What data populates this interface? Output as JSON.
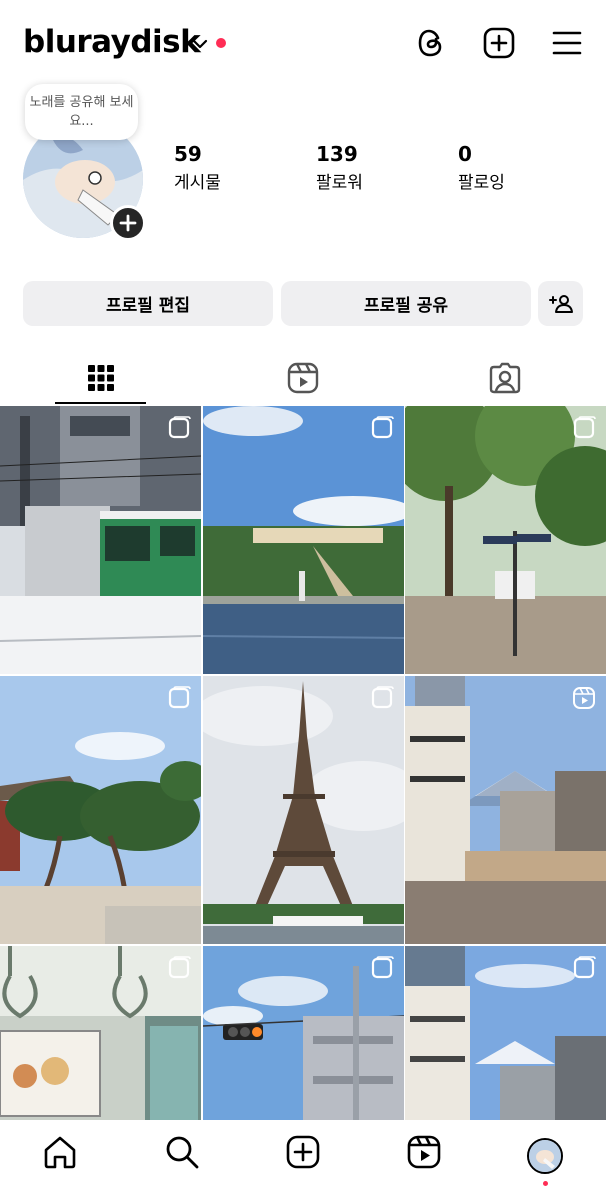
{
  "header": {
    "username": "bluraydisk"
  },
  "profile": {
    "note": "노래를 공유해 보세요...",
    "stats": [
      {
        "value": "59",
        "label": "게시물"
      },
      {
        "value": "139",
        "label": "팔로워"
      },
      {
        "value": "0",
        "label": "팔로잉"
      }
    ]
  },
  "buttons": {
    "edit_profile": "프로필 편집",
    "share_profile": "프로필 공유"
  },
  "tabs": [
    {
      "icon": "grid-icon",
      "selected": true
    },
    {
      "icon": "reels-icon",
      "selected": false
    },
    {
      "icon": "tagged-icon",
      "selected": false
    }
  ],
  "posts": [
    {
      "subject": "snowy tram street",
      "type": "carousel"
    },
    {
      "subject": "palace with fountain",
      "type": "carousel"
    },
    {
      "subject": "park path with trees",
      "type": "carousel"
    },
    {
      "subject": "pine trees and temple",
      "type": "carousel"
    },
    {
      "subject": "eiffel tower",
      "type": "carousel"
    },
    {
      "subject": "city street with mount fuji",
      "type": "reel"
    },
    {
      "subject": "train interior",
      "type": "carousel"
    },
    {
      "subject": "traffic light and buildings",
      "type": "carousel"
    },
    {
      "subject": "building with mount fuji",
      "type": "carousel"
    }
  ],
  "colors": {
    "accent_red": "#ff2d55",
    "button_bg": "#efeff1"
  },
  "bottom_nav": [
    "home-icon",
    "search-icon",
    "create-icon",
    "reels-icon",
    "profile-avatar"
  ]
}
